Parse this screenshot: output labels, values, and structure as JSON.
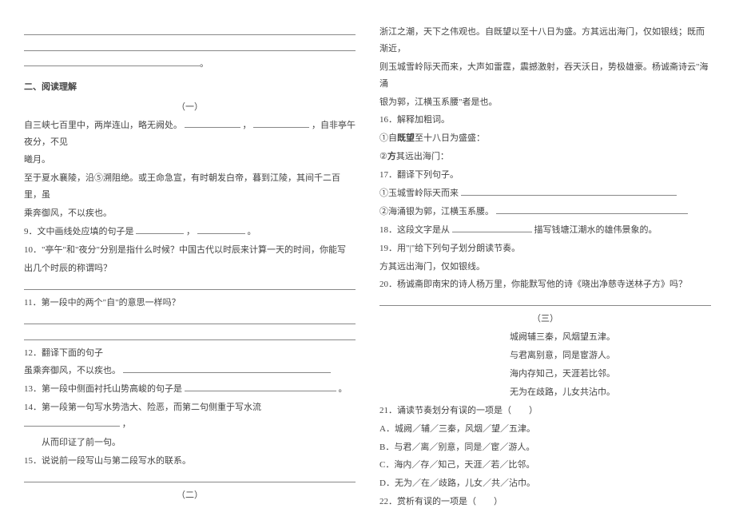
{
  "left": {
    "section_title": "二、阅读理解",
    "passage1_label": "（一）",
    "p1_l1a": "自三峡七百里中，两岸连山，略无阙处。",
    "p1_l1b": "，",
    "p1_l1c": "，自非亭午夜分，不见",
    "p1_l2": "曦月。",
    "p1_l3": "至于夏水襄陵，沿⑤溯阻绝。或王命急宣，有时朝发白帝，暮到江陵，其间千二百里，虽",
    "p1_l4": "乘奔御风，不以疾也。",
    "q9a": "9．文中画线处应填的句子是",
    "q9b": "，",
    "q9c": "。",
    "q10_l1": "10．\"亭午\"和\"夜分\"分别是指什么时候？中国古代以时辰来计算一天的时间，你能写",
    "q10_l2": "出几个时辰的称谓吗？",
    "q11": "11．第一段中的两个\"自\"的意思一样吗？",
    "q12_l1": "12．翻译下面的句子",
    "q12_l2": "虽乘奔御风，不以疾也。",
    "q13a": "13．第一段中侧面衬托山势高峻的句子是",
    "q13b": "。",
    "q14_l1a": "14．第一段第一句写水势浩大、险恶，而第二句侧重于写水流",
    "q14_l1b": "，",
    "q14_l2": "从而印证了前一句。",
    "q15": "15．说说前一段写山与第二段写水的联系。",
    "passage2_label": "（二）"
  },
  "right": {
    "p2_l1": "浙江之潮，天下之伟观也。自既望以至十八日为盛。方其远出海门，仅如银线；既而渐近，",
    "p2_l2": "则玉城雪岭际天而来，大声如雷霆，震撼激射，吞天沃日，势极雄豪。杨诚斋诗云\"海涌",
    "p2_l3": "银为郭，江横玉系腰\"者是也。",
    "q16": "16．解释加粗词。",
    "q16_1a": "①自",
    "q16_1bold": "既望",
    "q16_1b": "至十八日为盛盛：",
    "q16_2a": "②",
    "q16_2bold": "方",
    "q16_2b": "其远出海门：",
    "q17": "17．翻译下列句子。",
    "q17_1": "①玉城雪岭际天而来",
    "q17_2": "②海涌银为郭，江横玉系腰。",
    "q18a": "18．这段文字是从",
    "q18b": "描写钱塘江潮水的雄伟景象的。",
    "q19": "19．用\"|\"给下列句子划分朗读节奏。",
    "q19_text": "方其远出海门，仅如银线。",
    "q20": "20．杨诚斋即南宋的诗人杨万里，你能默写他的诗《晓出净慈寺送林子方》吗？",
    "passage3_label": "（三）",
    "poem_l1": "城阙辅三秦，风烟望五津。",
    "poem_l2": "与君离别意，同是宦游人。",
    "poem_l3": "海内存知己，天涯若比邻。",
    "poem_l4": "无为在歧路，儿女共沾巾。",
    "q21": "21．诵读节奏划分有误的一项是（　　）",
    "q21_a": "A．城阙／辅／三秦，风烟／望／五津。",
    "q21_b": "B．与君／离／别意，同是／宦／游人。",
    "q21_c": "C．海内／存／知己，天涯／若／比邻。",
    "q21_d": "D．无为／在／歧路，儿女／共／沾巾。",
    "q22": "22．赏析有误的一项是（　　）"
  }
}
